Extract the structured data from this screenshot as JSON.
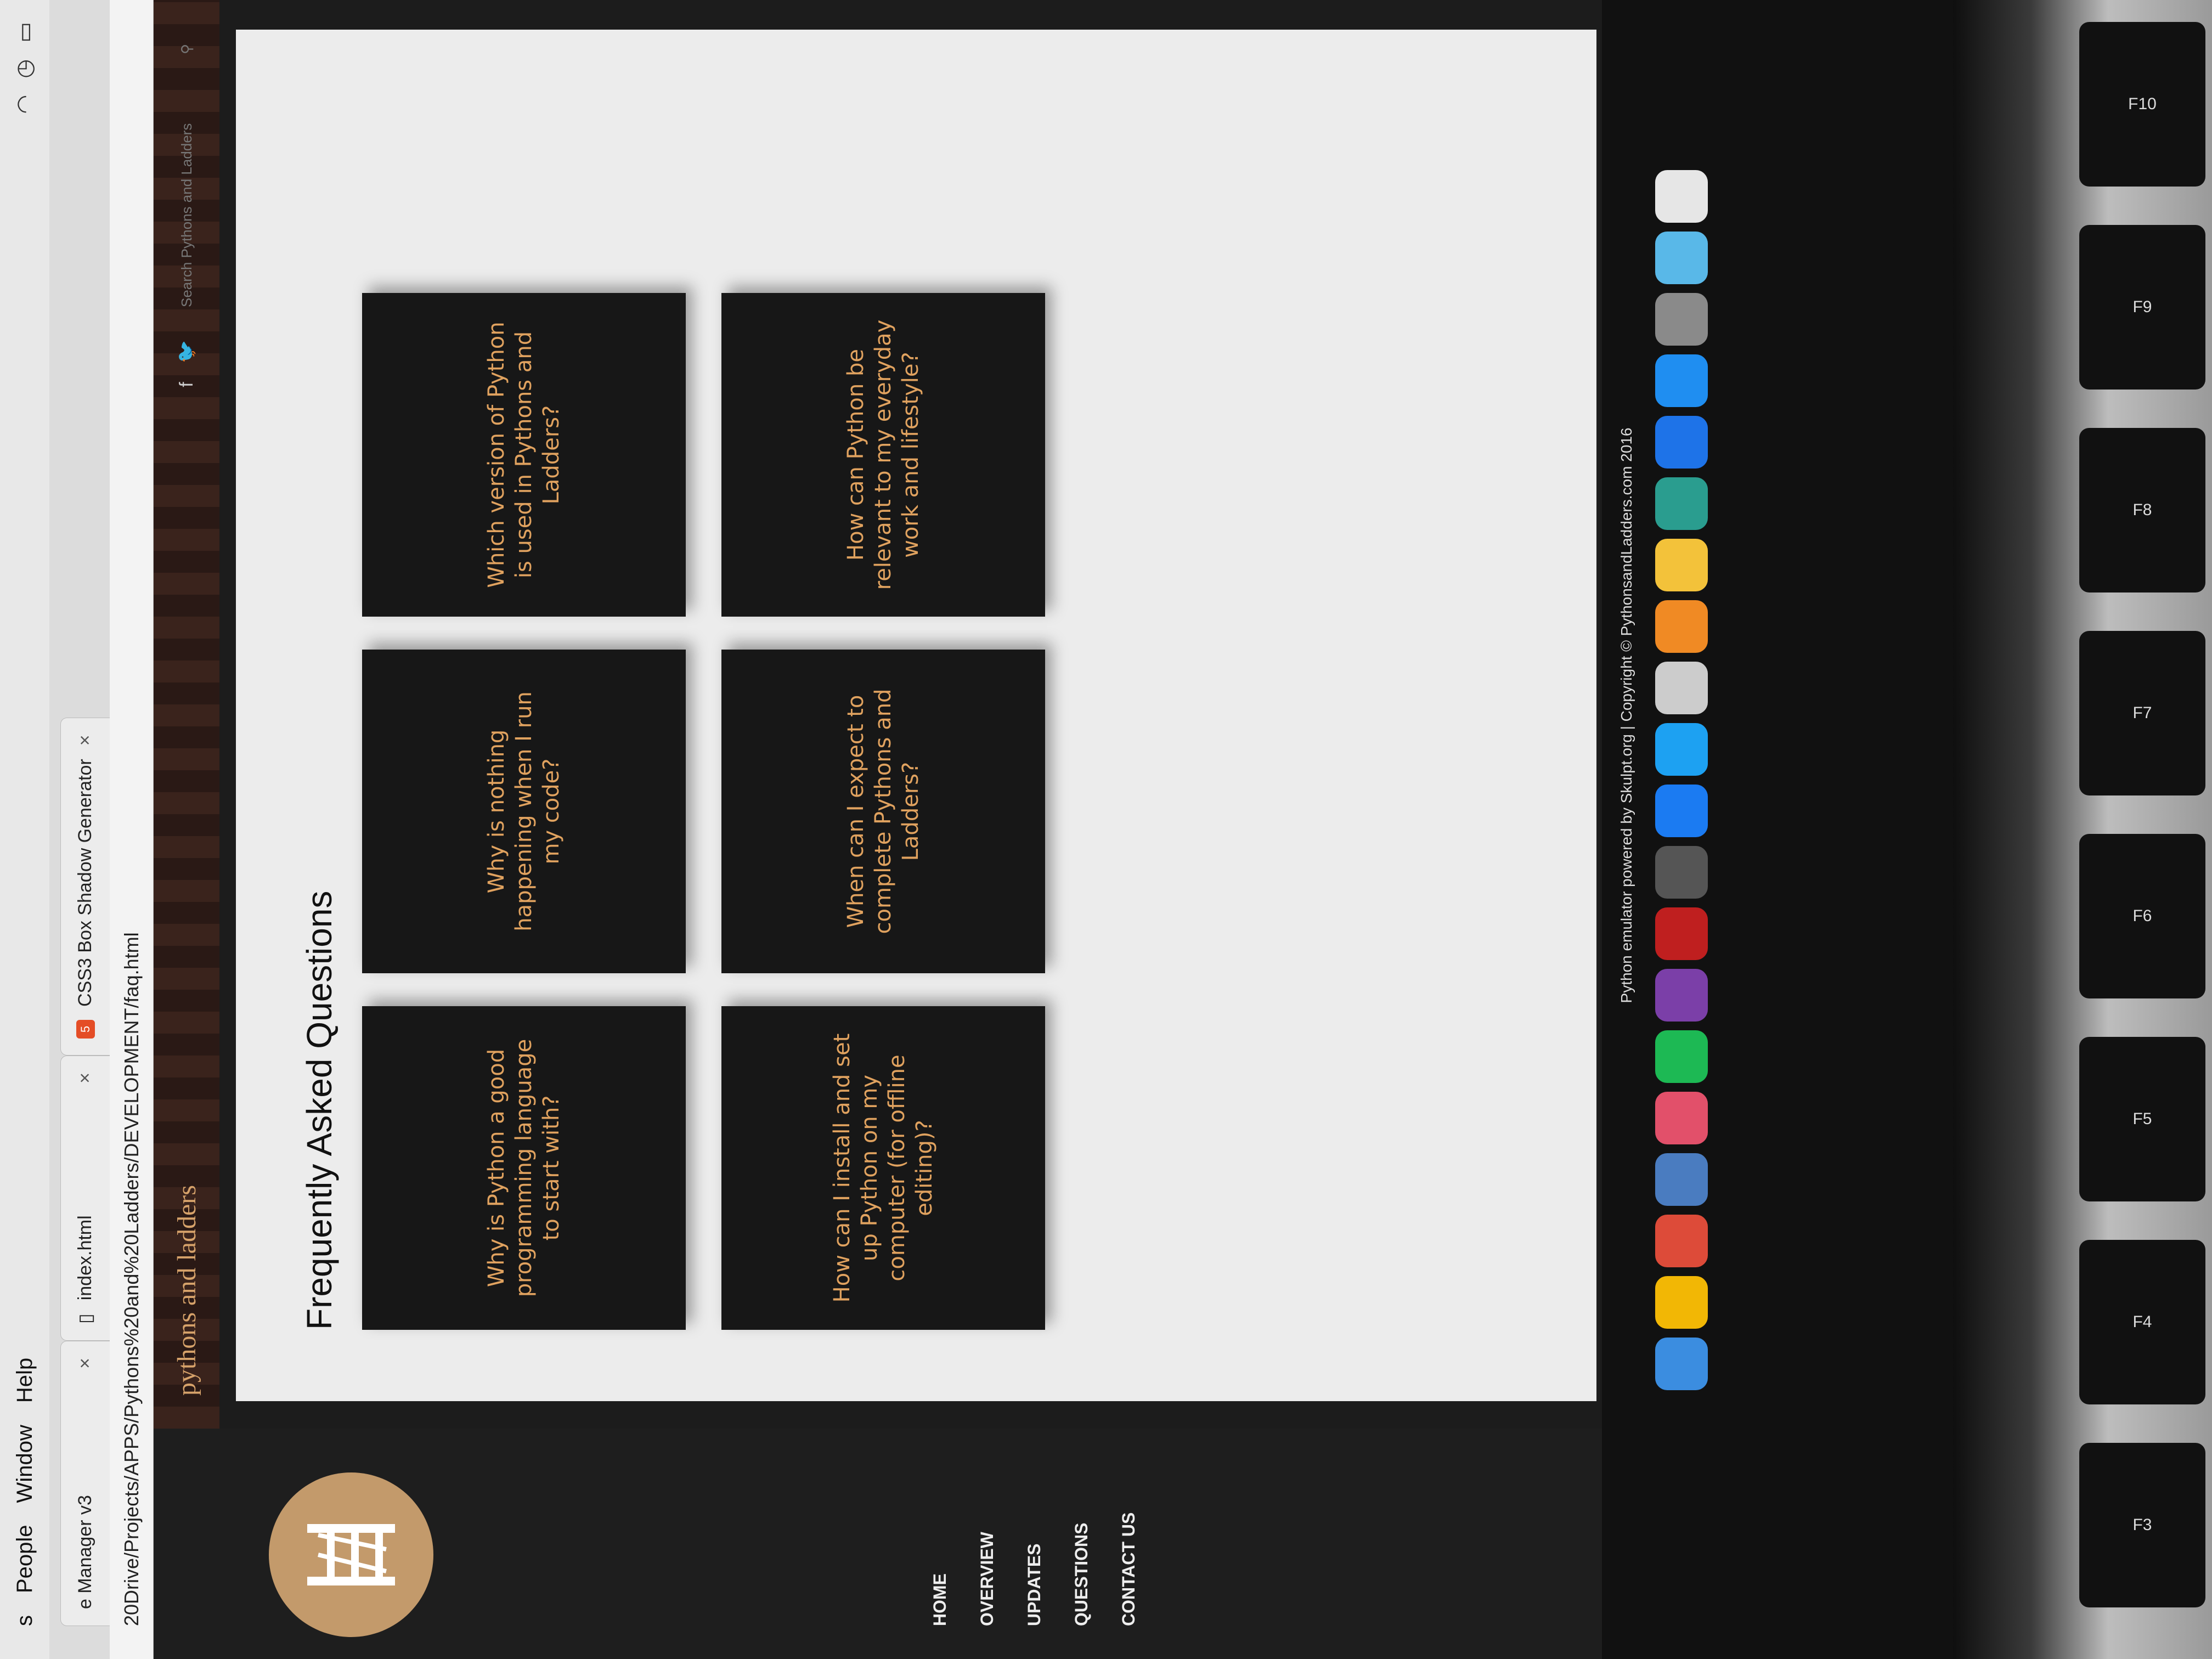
{
  "os_menu": {
    "items": [
      "s",
      "People",
      "Window",
      "Help"
    ]
  },
  "browser": {
    "tabs": [
      {
        "label": "e Manager v3"
      },
      {
        "label": "index.html"
      },
      {
        "label": "CSS3 Box Shadow Generator"
      }
    ],
    "address": "20Drive/Projects/APPS/Pythons%20and%20Ladders/DEVELOPMENT/faq.html"
  },
  "site": {
    "brand": "pythons and ladders",
    "search_placeholder": "Search Pythons and Ladders",
    "nav": [
      "HOME",
      "OVERVIEW",
      "UPDATES",
      "QUESTIONS",
      "CONTACT US"
    ],
    "page_title": "Frequently Asked Questions",
    "faq": [
      "Why is Python a good programming language to start with?",
      "Why is nothing happening when I run my code?",
      "Which version of Python is used in Pythons and Ladders?",
      "How can I install and set up Python on my computer (for offline editing)?",
      "When can I expect to complete Pythons and Ladders?",
      "How can Python be relevant to my everyday work and lifestyle?"
    ],
    "footer": "Python emulator powered by Skulpt.org | Copyright © PythonsandLadders.com 2016"
  },
  "dock": [
    {
      "name": "finder",
      "color": "#3b8de0"
    },
    {
      "name": "google-drive",
      "color": "#f2b705"
    },
    {
      "name": "chrome",
      "color": "#dd4b39"
    },
    {
      "name": "preview",
      "color": "#4a7cc0"
    },
    {
      "name": "itunes",
      "color": "#e2506a"
    },
    {
      "name": "spotify",
      "color": "#1db954"
    },
    {
      "name": "onenote",
      "color": "#7b3fa8"
    },
    {
      "name": "filezilla",
      "color": "#bf1f1f"
    },
    {
      "name": "sublime",
      "color": "#555555"
    },
    {
      "name": "messenger",
      "color": "#1b7bf2"
    },
    {
      "name": "twitter",
      "color": "#1da1f2"
    },
    {
      "name": "disk-utility",
      "color": "#cccccc"
    },
    {
      "name": "ibooks",
      "color": "#f08a24"
    },
    {
      "name": "photos",
      "color": "#f3c23a"
    },
    {
      "name": "circle-app",
      "color": "#2a9d8f"
    },
    {
      "name": "sync",
      "color": "#1e73e8"
    },
    {
      "name": "app-store",
      "color": "#1f8ef1"
    },
    {
      "name": "system-preferences",
      "color": "#8a8a8a"
    },
    {
      "name": "folder",
      "color": "#59b8e8"
    },
    {
      "name": "trash",
      "color": "#e6e6e6"
    }
  ],
  "keys": [
    "F3",
    "F4",
    "F5",
    "F6",
    "F7",
    "F8",
    "F9",
    "F10"
  ],
  "colors": {
    "accent": "#e0a25f",
    "card": "#171717",
    "page": "#ececec"
  }
}
